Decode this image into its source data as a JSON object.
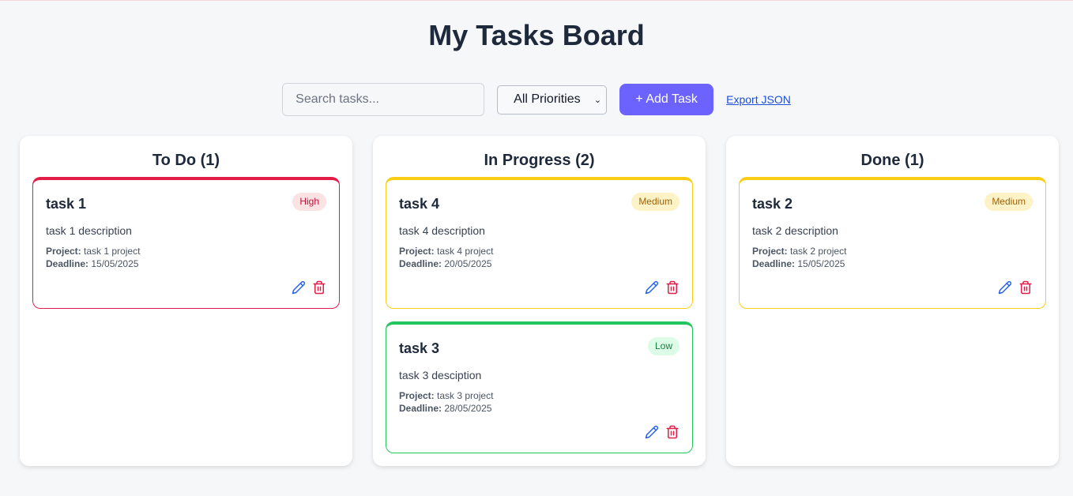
{
  "page": {
    "title": "My Tasks Board"
  },
  "toolbar": {
    "search_placeholder": "Search tasks...",
    "priority_filter": "All Priorities",
    "add_label": "+ Add Task",
    "export_label": "Export JSON"
  },
  "colors": {
    "accent": "#6c63ff",
    "high": "#e11d48",
    "medium": "#facc15",
    "low": "#22c55e",
    "edit_icon": "#2563eb",
    "delete_icon": "#e11d48"
  },
  "labels": {
    "project": "Project:",
    "deadline": "Deadline:"
  },
  "columns": [
    {
      "title": "To Do (1)",
      "cards": [
        {
          "title": "task 1",
          "priority": "High",
          "description": "task 1 description",
          "project": "task 1 project",
          "deadline": "15/05/2025"
        }
      ]
    },
    {
      "title": "In Progress (2)",
      "cards": [
        {
          "title": "task 4",
          "priority": "Medium",
          "description": "task 4 description",
          "project": "task 4 project",
          "deadline": "20/05/2025"
        },
        {
          "title": "task 3",
          "priority": "Low",
          "description": "task 3 desciption",
          "project": "task 3 project",
          "deadline": "28/05/2025"
        }
      ]
    },
    {
      "title": "Done (1)",
      "cards": [
        {
          "title": "task 2",
          "priority": "Medium",
          "description": "task 2 description",
          "project": "task 2 project",
          "deadline": "15/05/2025"
        }
      ]
    }
  ]
}
